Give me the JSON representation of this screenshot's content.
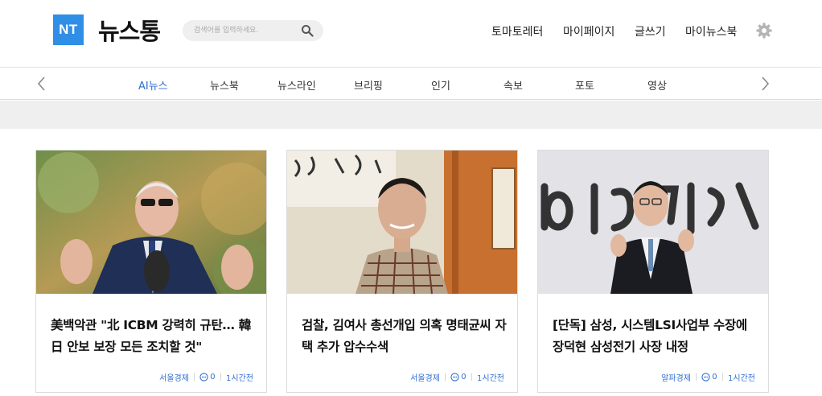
{
  "brand": {
    "badge": "NT",
    "name": "뉴스통"
  },
  "search": {
    "placeholder": "검색어를 입력하세요."
  },
  "top_menu": [
    "토마토레터",
    "마이페이지",
    "글쓰기",
    "마이뉴스북"
  ],
  "categories": [
    "AI뉴스",
    "뉴스북",
    "뉴스라인",
    "브리핑",
    "인기",
    "속보",
    "포토",
    "영상"
  ],
  "active_category": "AI뉴스",
  "colors": {
    "brand_blue": "#2f8ee6",
    "accent_blue": "#2f6fd1"
  },
  "icons": {
    "search": "search-icon",
    "settings": "gear-icon",
    "prev": "chevron-left-icon",
    "next": "chevron-right-icon",
    "comment": "comment-icon"
  },
  "articles": [
    {
      "title": "美백악관 \"北 ICBM 강력히 규탄… 韓日 안보 보장 모든 조치할 것\"",
      "source": "서울경제",
      "comments": "0",
      "time": "1시간전"
    },
    {
      "title": "검찰, 김여사 총선개입 의혹 명태균씨 자택 추가 압수수색",
      "source": "서울경제",
      "comments": "0",
      "time": "1시간전"
    },
    {
      "title": "[단독] 삼성, 시스템LSI사업부 수장에 장덕현 삼성전기 사장 내정",
      "source": "알파경제",
      "comments": "0",
      "time": "1시간전"
    }
  ]
}
